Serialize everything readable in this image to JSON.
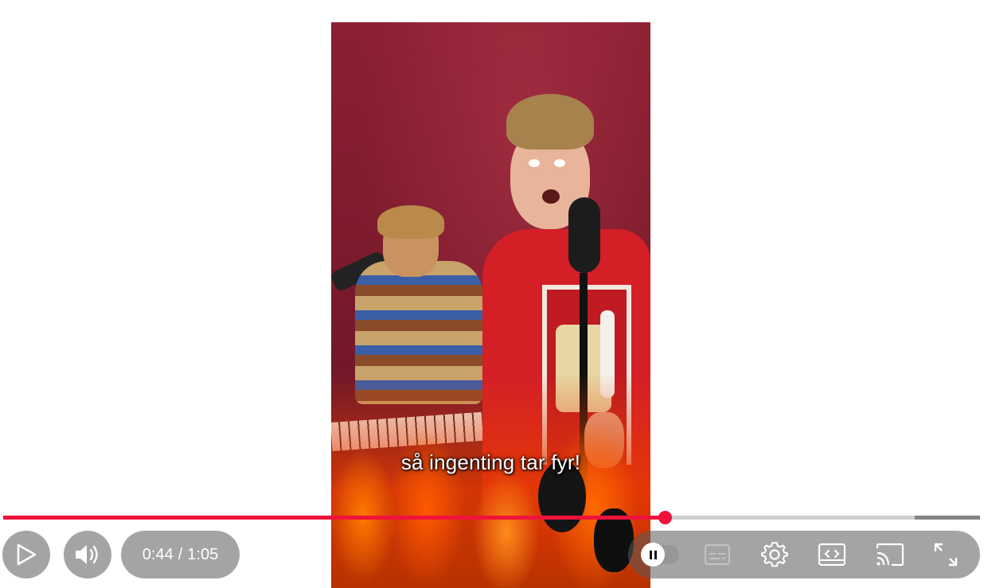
{
  "video": {
    "caption": "så ingenting tar fyr!"
  },
  "progress": {
    "played_fraction": 0.677,
    "buffered_fraction": 0.933
  },
  "controls": {
    "current_time": "0:44",
    "separator": "/",
    "duration": "1:05",
    "autoplay_state": "on"
  },
  "icons": [
    "play-icon",
    "volume-icon",
    "autoplay-toggle",
    "subtitles-icon",
    "settings-gear-icon",
    "miniplayer-icon",
    "cast-icon",
    "fullscreen-icon"
  ],
  "colors": {
    "accent": "#f0133c",
    "control_bg": "rgba(90,90,90,0.55)",
    "icon": "#ffffff"
  }
}
